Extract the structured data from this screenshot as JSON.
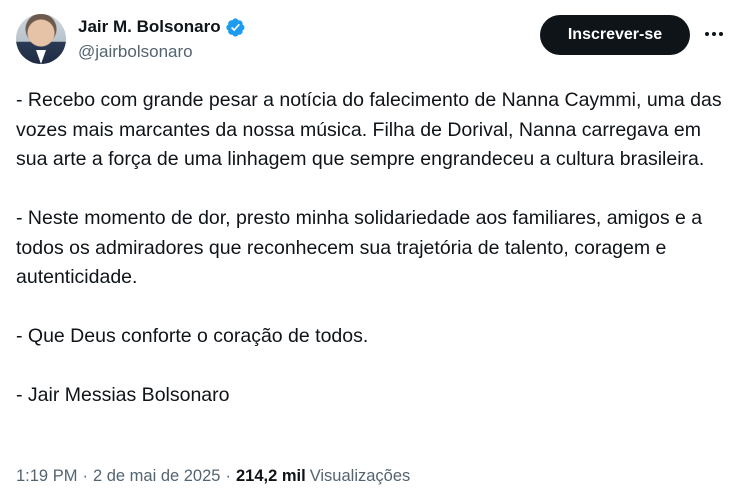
{
  "author": {
    "display_name": "Jair M. Bolsonaro",
    "handle": "@jairbolsonaro",
    "verified_icon": "verified-badge-icon",
    "verified_color": "#1d9bf0"
  },
  "actions": {
    "follow_label": "Inscrever-se",
    "more_icon": "more-horizontal-icon"
  },
  "tweet": {
    "paragraphs": [
      "- Recebo com grande pesar a notícia do falecimento de Nanna Caymmi, uma das vozes mais marcantes da nossa música. Filha de Dorival, Nanna carregava em sua arte a força de uma linhagem que sempre engrandeceu a cultura brasileira.",
      "- Neste momento de dor, presto minha solidariedade aos familiares, amigos e a todos os admiradores que reconhecem sua trajetória de talento, coragem e autenticidade.",
      "- Que Deus conforte o coração de todos.",
      "- Jair Messias Bolsonaro"
    ]
  },
  "meta": {
    "time": "1:19 PM",
    "separator": "·",
    "date": "2 de mai de 2025",
    "views_count": "214,2 mil",
    "views_label": "Visualizações"
  }
}
